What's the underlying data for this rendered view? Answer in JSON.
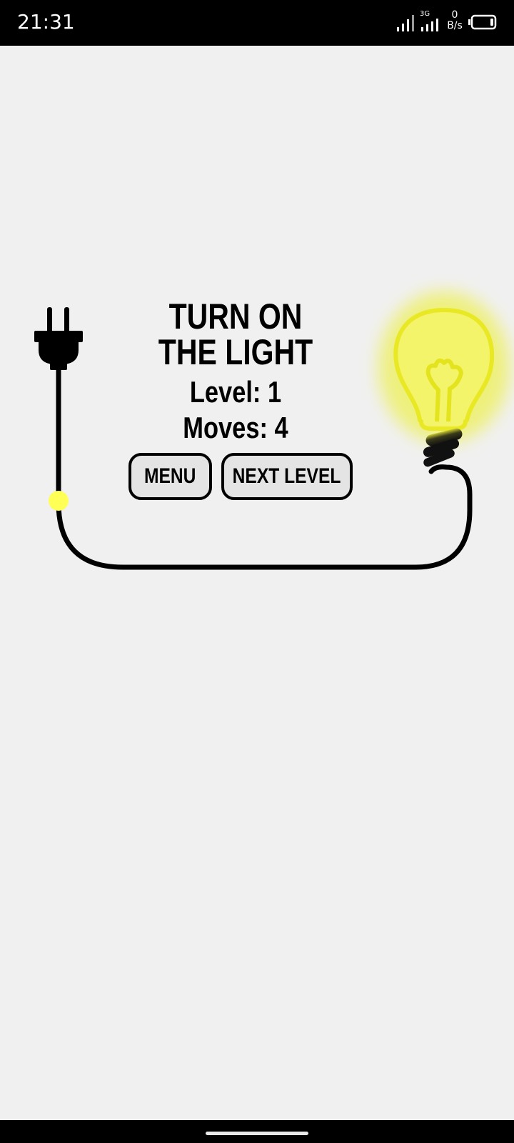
{
  "status_bar": {
    "time": "21:31",
    "network_type": "3G",
    "net_speed_value": "0",
    "net_speed_unit": "B/s",
    "icons": [
      "signal-icon",
      "signal-3g-icon",
      "battery-icon"
    ]
  },
  "game": {
    "title_line_1": "TURN ON",
    "title_line_2": "THE LIGHT",
    "level_text": "Level: 1",
    "moves_text": "Moves: 4",
    "menu_label": "MENU",
    "next_level_label": "NEXT LEVEL",
    "bulb_state": "on",
    "icons": [
      "plug-icon",
      "light-bulb-icon",
      "power-node-icon"
    ]
  },
  "colors": {
    "background": "#f0f0f0",
    "bar": "#000000",
    "glow": "#f5f56a",
    "node": "#ffff55",
    "button_fill": "#e4e4e4"
  }
}
